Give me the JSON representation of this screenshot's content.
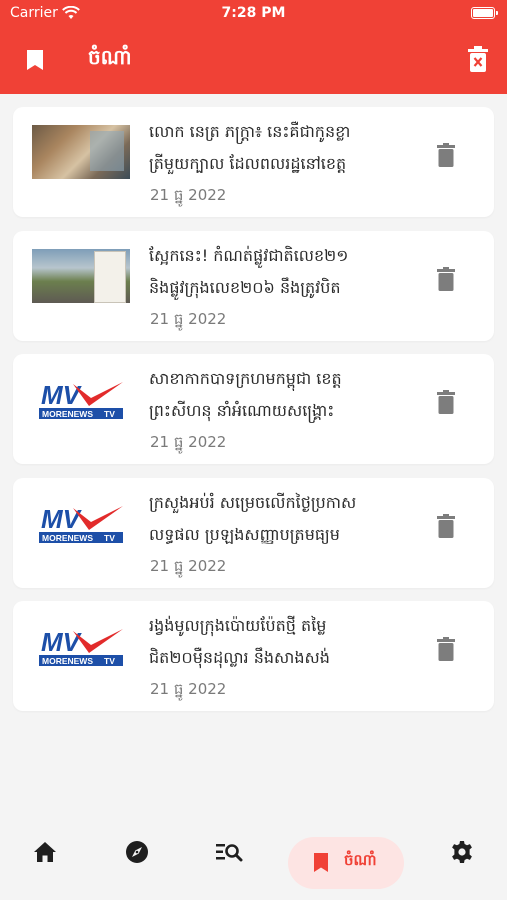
{
  "status": {
    "carrier": "Carrier",
    "time": "7:28 PM"
  },
  "header": {
    "title": "ចំណាំ",
    "left_icon": "bookmark-icon",
    "right_icon": "delete-all-icon"
  },
  "articles": [
    {
      "thumb": "photo",
      "title_line1": "លោក នេត្រ ភក្ត្រា៖ នេះគឺជាកូនខ្លា",
      "title_line2": "ត្រីមួយក្បាល ដែលពលរដ្ឋនៅខេត្ត",
      "date": "21 ធ្នូ 2022"
    },
    {
      "thumb": "photo",
      "title_line1": "ស្អែកនេះ! កំណត់ផ្លូវជាតិលេខ២១",
      "title_line2": "និងផ្លូវក្រុងលេខ២០៦ នឹងត្រូវបិត",
      "date": "21 ធ្នូ 2022"
    },
    {
      "thumb": "logo",
      "title_line1": "សាខាកាកបាទក្រហមកម្ពុជា ខេត្ត",
      "title_line2": "ព្រះសីហនុ នាំអំណោយសង្គ្រោះ",
      "date": "21 ធ្នូ 2022"
    },
    {
      "thumb": "logo",
      "title_line1": "ក្រសួងអប់រំ សម្រេចលើកថ្ងៃប្រកាស",
      "title_line2": "លទ្ធផល ប្រឡងសញ្ញាបត្រមធ្យម",
      "date": "21 ធ្នូ 2022"
    },
    {
      "thumb": "logo",
      "title_line1": "រង្វង់មូលក្រុងប៉ោយប៉ែតថ្មី តម្លៃ",
      "title_line2": "ជិត២០ម៉ឺនដុល្លារ នឹងសាងសង់",
      "date": "21 ធ្នូ 2022"
    }
  ],
  "logo_text": {
    "mv": "MV",
    "brand": "MORENEWS",
    "tv": "TV"
  },
  "bottom_nav": {
    "active_label": "ចំណាំ",
    "items": [
      "home-icon",
      "explore-icon",
      "search-list-icon",
      "bookmark-icon",
      "settings-icon"
    ]
  },
  "colors": {
    "primary": "#f04136",
    "active_pill": "#fde4e3",
    "background": "#f4f4f4",
    "icon_gray": "#7d7d7d"
  }
}
